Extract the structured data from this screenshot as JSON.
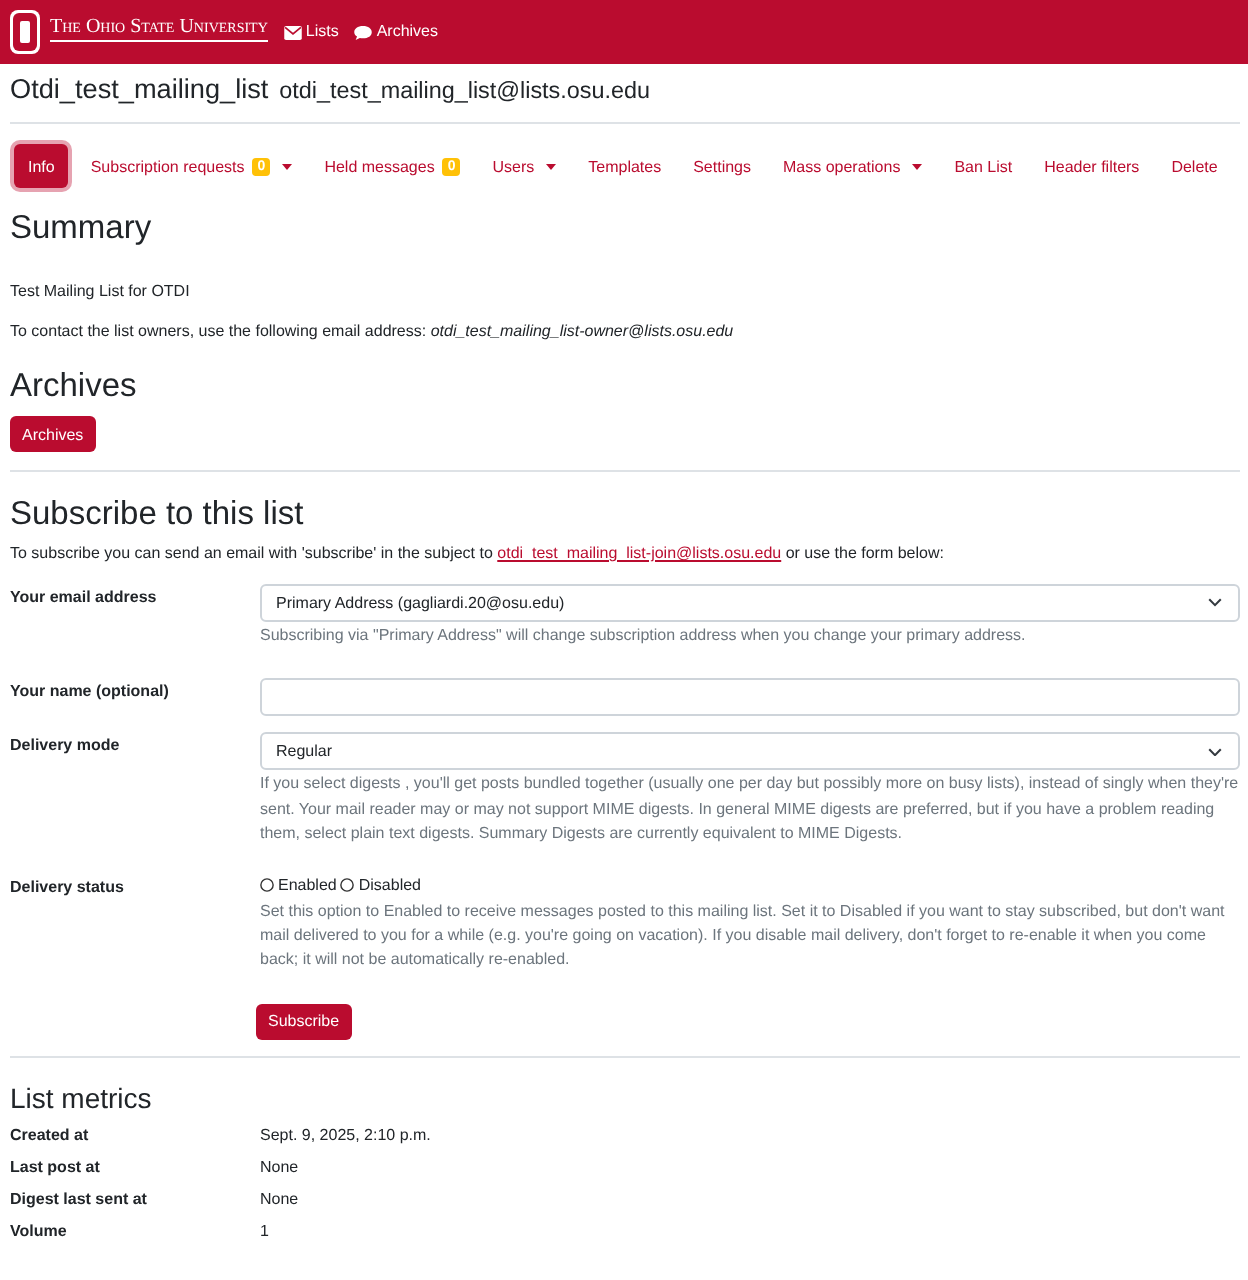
{
  "header": {
    "brand": "The Ohio State University",
    "lists_link": "Lists",
    "archives_link": "Archives"
  },
  "list": {
    "name": "Otdi_test_mailing_list",
    "address": "otdi_test_mailing_list@lists.osu.edu"
  },
  "tabs": [
    {
      "label": "Info",
      "selected": true,
      "dropdown": false
    },
    {
      "label": "Subscription requests",
      "badge": "0",
      "selected": false,
      "dropdown": true
    },
    {
      "label": "Held messages",
      "badge": "0",
      "selected": false,
      "dropdown": false
    },
    {
      "label": "Users",
      "selected": false,
      "dropdown": true
    },
    {
      "label": "Templates",
      "selected": false,
      "dropdown": false
    },
    {
      "label": "Settings",
      "selected": false,
      "dropdown": false
    },
    {
      "label": "Mass operations",
      "selected": false,
      "dropdown": true
    },
    {
      "label": "Ban List",
      "selected": false,
      "dropdown": false
    },
    {
      "label": "Header filters",
      "selected": false,
      "dropdown": false
    },
    {
      "label": "Delete",
      "selected": false,
      "dropdown": false
    }
  ],
  "summary": {
    "heading": "Summary",
    "description": "Test Mailing List for OTDI",
    "contact": "To contact the list owners, use the following email address: *otdi_test_mailing_list-owner@lists.osu.edu*"
  },
  "archives": {
    "heading": "Archives",
    "button": "Archives"
  },
  "subscribe": {
    "heading": "Subscribe to this list",
    "intro_before": "To subscribe you can send an email with 'subscribe' in the subject to",
    "intro_link": "otdi_test_mailing_list-join@lists.osu.edu",
    "intro_after": "or use the form below:",
    "fields": [
      {
        "kind": "select",
        "label": "Your email address",
        "value": "Primary Address (gagliardi.20@osu.edu)",
        "help": "Subscribing via \"Primary Address\" will change subscription address when you change your primary address."
      },
      {
        "kind": "text",
        "label": "Your name (optional)"
      },
      {
        "kind": "select",
        "label": "Delivery mode",
        "value": "Regular",
        "help": "If you select digests , you'll get posts bundled together (usually one per day but possibly more on busy lists), instead of singly when they're sent. Your mail reader may or may not support MIME digests. In general MIME digests are preferred, but if you have a problem reading them, select plain text digests. Summary Digests are currently equivalent to MIME Digests."
      },
      {
        "kind": "radio",
        "label": "Delivery status",
        "options": [
          {
            "label": "Enabled",
            "selected": false
          },
          {
            "label": "Disabled",
            "selected": false
          }
        ],
        "help": "Set this option to Enabled to receive messages posted to this mailing list. Set it to Disabled if you want to stay subscribed, but don't want mail delivered to you for a while (e.g. you're going on vacation). If you disable mail delivery, don't forget to re-enable it when you come back; it will not be automatically re-enabled."
      }
    ],
    "button": "Subscribe"
  },
  "metrics": {
    "heading": "List metrics",
    "rows": [
      {
        "label": "Created at",
        "value": "Sept. 9, 2025, 2:10 p.m."
      },
      {
        "label": "Last post at",
        "value": "None"
      },
      {
        "label": "Digest last sent at",
        "value": "None"
      },
      {
        "label": "Volume",
        "value": "1"
      }
    ]
  }
}
